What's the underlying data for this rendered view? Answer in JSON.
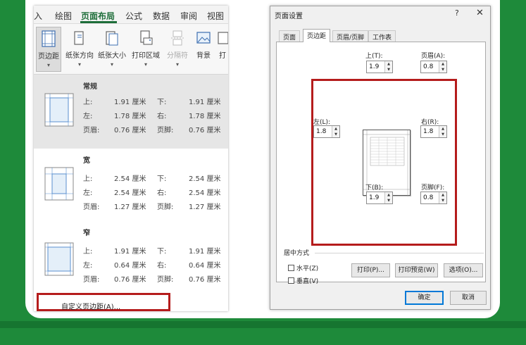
{
  "ribbon": {
    "tabs": [
      "插入",
      "绘图",
      "页面布局",
      "公式",
      "数据",
      "审阅",
      "视图"
    ],
    "tab_visible": [
      "入",
      "绘图",
      "页面布局",
      "公式",
      "数据",
      "审阅",
      "视图"
    ],
    "active_tab": "页面布局",
    "buttons": [
      {
        "label": "页边距",
        "icon": "margins-icon",
        "selected": true
      },
      {
        "label": "纸张方向",
        "icon": "orientation-icon"
      },
      {
        "label": "纸张大小",
        "icon": "paper-size-icon"
      },
      {
        "label": "打印区域",
        "icon": "print-area-icon"
      },
      {
        "label": "分隔符",
        "icon": "breaks-icon",
        "disabled": true
      },
      {
        "label": "背景",
        "icon": "background-icon"
      },
      {
        "label": "打",
        "icon": "print-titles-icon"
      }
    ]
  },
  "margin_options": [
    {
      "name": "常规",
      "top_label": "上:",
      "top": "1.91 厘米",
      "bottom_label": "下:",
      "bottom": "1.91 厘米",
      "left_label": "左:",
      "left": "1.78 厘米",
      "right_label": "右:",
      "right": "1.78 厘米",
      "header_label": "页眉:",
      "header": "0.76 厘米",
      "footer_label": "页脚:",
      "footer": "0.76 厘米"
    },
    {
      "name": "宽",
      "top_label": "上:",
      "top": "2.54 厘米",
      "bottom_label": "下:",
      "bottom": "2.54 厘米",
      "left_label": "左:",
      "left": "2.54 厘米",
      "right_label": "右:",
      "right": "2.54 厘米",
      "header_label": "页眉:",
      "header": "1.27 厘米",
      "footer_label": "页脚:",
      "footer": "1.27 厘米"
    },
    {
      "name": "窄",
      "top_label": "上:",
      "top": "1.91 厘米",
      "bottom_label": "下:",
      "bottom": "1.91 厘米",
      "left_label": "左:",
      "left": "0.64 厘米",
      "right_label": "右:",
      "right": "0.64 厘米",
      "header_label": "页眉:",
      "header": "0.76 厘米",
      "footer_label": "页脚:",
      "footer": "0.76 厘米"
    }
  ],
  "custom_margins_label": "自定义页边距(A)...",
  "dialog": {
    "title": "页面设置",
    "help": "?",
    "close": "✕",
    "tabs": [
      "页面",
      "页边距",
      "页眉/页脚",
      "工作表"
    ],
    "active_tab": "页边距",
    "fields": {
      "top": {
        "label": "上(T):",
        "value": "1.9"
      },
      "header": {
        "label": "页眉(A):",
        "value": "0.8"
      },
      "left": {
        "label": "左(L):",
        "value": "1.8"
      },
      "right": {
        "label": "右(R):",
        "value": "1.8"
      },
      "bottom": {
        "label": "下(B):",
        "value": "1.9"
      },
      "footer": {
        "label": "页脚(F):",
        "value": "0.8"
      }
    },
    "center_on_page": {
      "title": "居中方式",
      "horizontal": "水平(Z)",
      "vertical": "垂直(V)"
    },
    "buttons": {
      "print": "打印(P)...",
      "print_preview": "打印预览(W)",
      "options": "选项(O)...",
      "ok": "确定",
      "cancel": "取消"
    }
  },
  "colors": {
    "background_green": "#1e8a3a",
    "highlight_red": "#b51c1c",
    "tab_green": "#1e6e3a"
  }
}
